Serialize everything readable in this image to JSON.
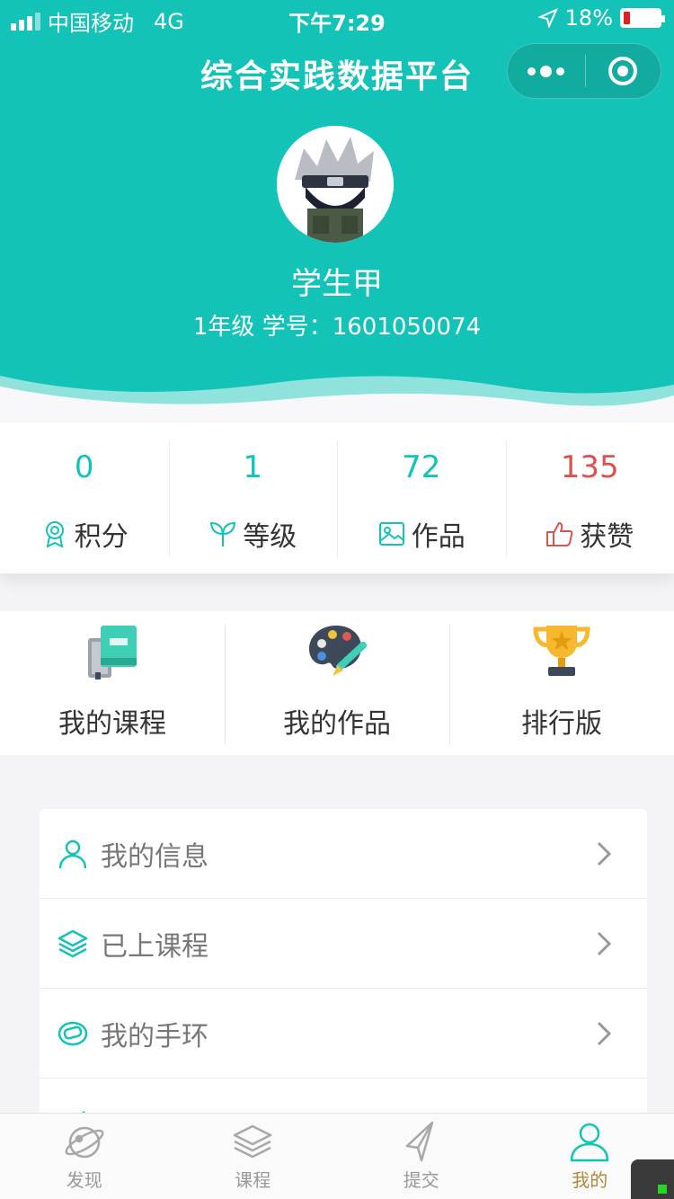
{
  "status": {
    "carrier": "中国移动",
    "network": "4G",
    "time": "下午7:29",
    "battery": "18%"
  },
  "colors": {
    "primary": "#14c3b7",
    "like": "#d9534f",
    "active_tab": "#b0893a"
  },
  "nav": {
    "title": "综合实践数据平台"
  },
  "profile": {
    "name": "学生甲",
    "grade": "1年级",
    "id_label": "学号：",
    "student_id": "1601050074"
  },
  "stats": [
    {
      "value": "0",
      "label": "积分",
      "icon": "medal-icon"
    },
    {
      "value": "1",
      "label": "等级",
      "icon": "sprout-icon"
    },
    {
      "value": "72",
      "label": "作品",
      "icon": "image-icon"
    },
    {
      "value": "135",
      "label": "获赞",
      "icon": "thumbs-up-icon"
    }
  ],
  "quick": [
    {
      "label": "我的课程",
      "icon": "books-icon"
    },
    {
      "label": "我的作品",
      "icon": "palette-icon"
    },
    {
      "label": "排行版",
      "icon": "trophy-icon"
    }
  ],
  "menu": [
    {
      "label": "我的信息",
      "icon": "user-icon"
    },
    {
      "label": "已上课程",
      "icon": "layers-icon"
    },
    {
      "label": "我的手环",
      "icon": "wristband-icon"
    }
  ],
  "tabs": [
    {
      "label": "发现",
      "icon": "planet-icon"
    },
    {
      "label": "课程",
      "icon": "layers-icon"
    },
    {
      "label": "提交",
      "icon": "paper-plane-icon"
    },
    {
      "label": "我的",
      "icon": "user-icon",
      "active": true
    }
  ]
}
